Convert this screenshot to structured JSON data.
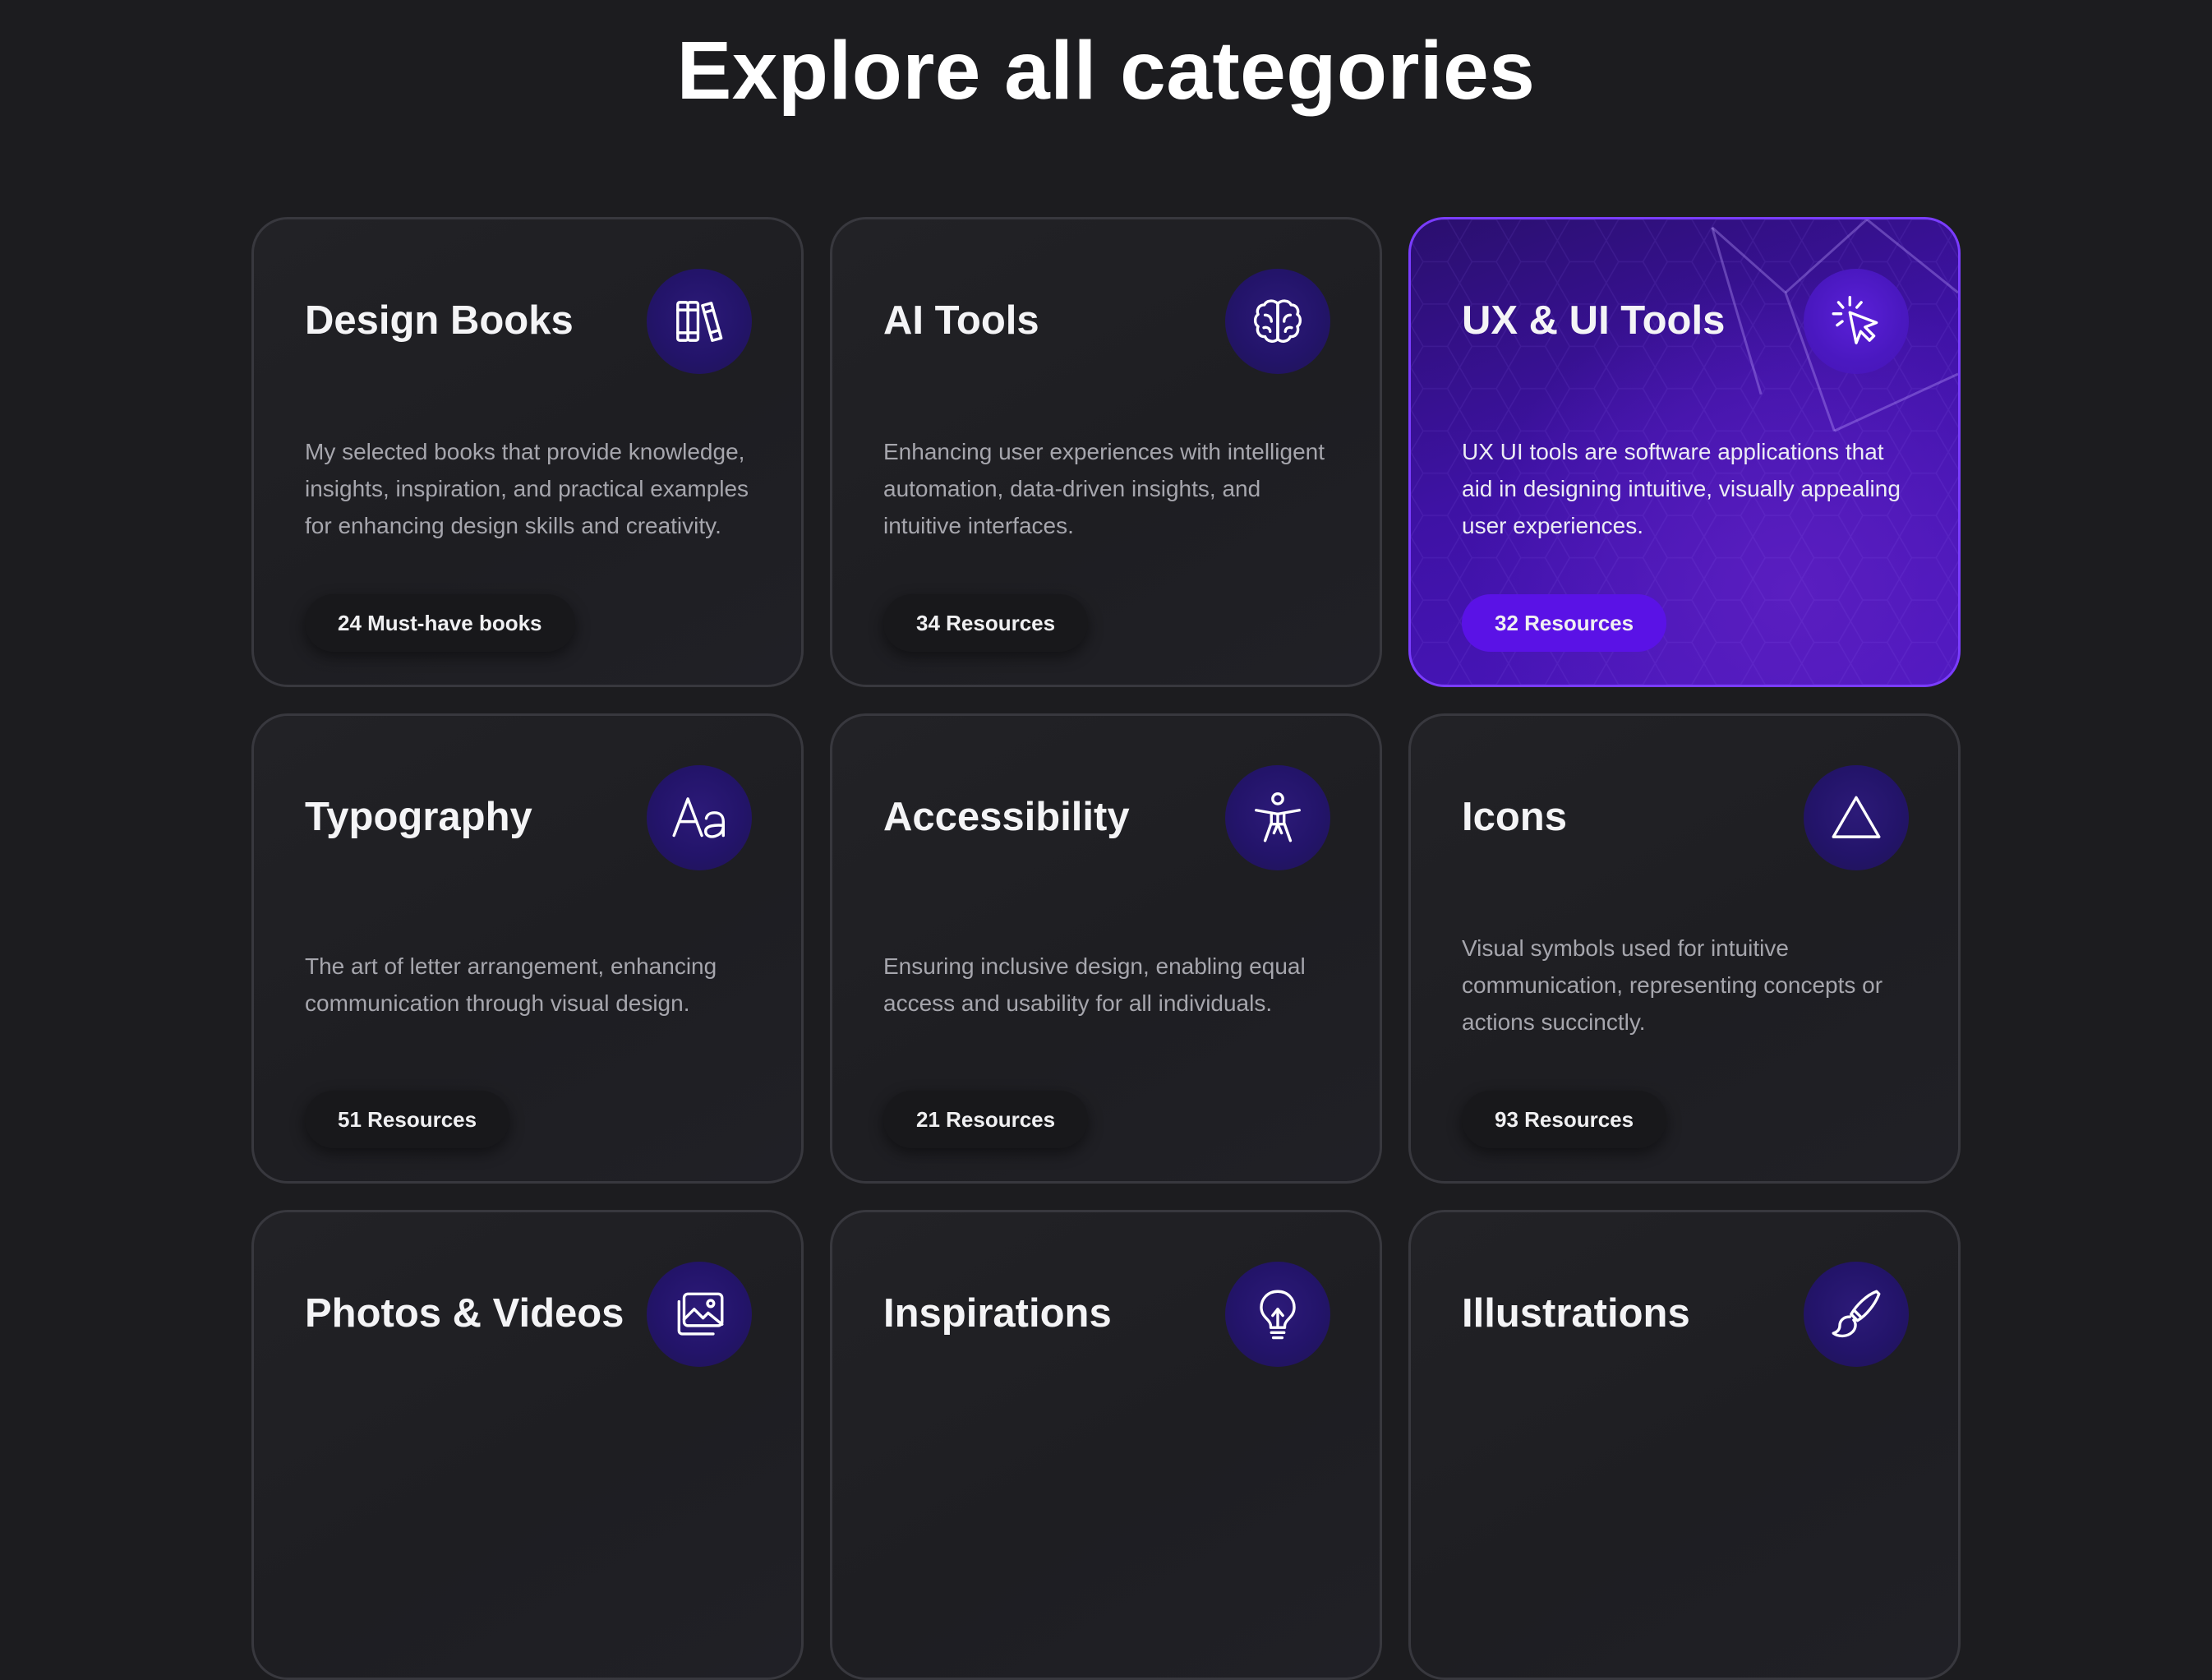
{
  "heading": "Explore all categories",
  "cards": [
    {
      "title": "Design Books",
      "icon": "books-icon",
      "description": "My selected books that provide knowledge, insights, inspiration, and practical examples for enhancing design skills and creativity.",
      "badge": "24 Must-have books"
    },
    {
      "title": "AI Tools",
      "icon": "brain-icon",
      "description": "Enhancing user experiences with intelligent automation, data-driven insights, and intuitive interfaces.",
      "badge": "34 Resources"
    },
    {
      "title": "UX & UI Tools",
      "icon": "cursor-click-icon",
      "description": "UX UI tools are software applications that aid in designing intuitive, visually appealing user experiences.",
      "badge": "32 Resources"
    },
    {
      "title": "Typography",
      "icon": "typography-icon",
      "description": "The art of letter arrangement, enhancing communication through visual design.",
      "badge": "51 Resources"
    },
    {
      "title": "Accessibility",
      "icon": "accessibility-icon",
      "description": "Ensuring inclusive design, enabling equal access and usability for all individuals.",
      "badge": "21 Resources"
    },
    {
      "title": "Icons",
      "icon": "triangle-icon",
      "description": "Visual symbols used for intuitive communication, representing concepts or actions succinctly.",
      "badge": "93 Resources"
    },
    {
      "title": "Photos & Videos",
      "icon": "photos-icon",
      "description": "",
      "badge": ""
    },
    {
      "title": "Inspirations",
      "icon": "lightbulb-icon",
      "description": "",
      "badge": ""
    },
    {
      "title": "Illustrations",
      "icon": "paintbrush-icon",
      "description": "",
      "badge": ""
    }
  ],
  "colors": {
    "background": "#1c1c1f",
    "accent": "#5a12e6",
    "highlight_border": "#7a3cff",
    "icon_circle": "#23146a"
  }
}
